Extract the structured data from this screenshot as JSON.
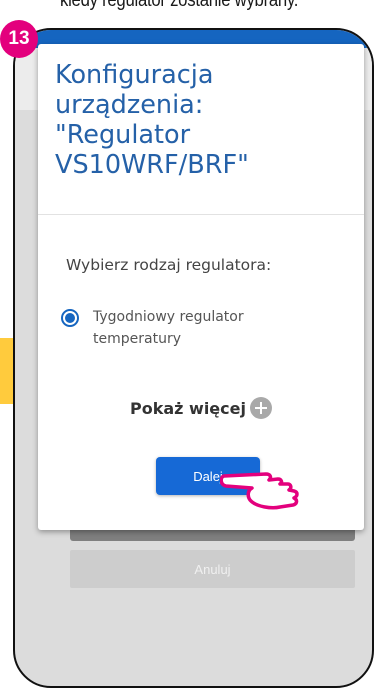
{
  "caption": "kiedy regulator zostanie wybrany.",
  "step_badge": "13",
  "dialog": {
    "title": "Konfiguracja\nurządzenia:\n\"Regulator\nVS10WRF/BRF\"",
    "prompt": "Wybierz rodzaj regulatora:",
    "option_label": "Tygodniowy regulator temperatury",
    "option_selected": true,
    "show_more_label": "Pokaż więcej",
    "next_label": "Dalej"
  },
  "background": {
    "cancel_label": "Anuluj"
  },
  "colors": {
    "accent_pink": "#e3007d",
    "primary_blue": "#1669d6",
    "title_blue": "#2561a8",
    "arrow_yellow": "#ffcb3d"
  },
  "icons": {
    "plus": "plus-circle-icon",
    "hand": "pointing-hand-icon",
    "radio": "radio-selected-icon"
  }
}
